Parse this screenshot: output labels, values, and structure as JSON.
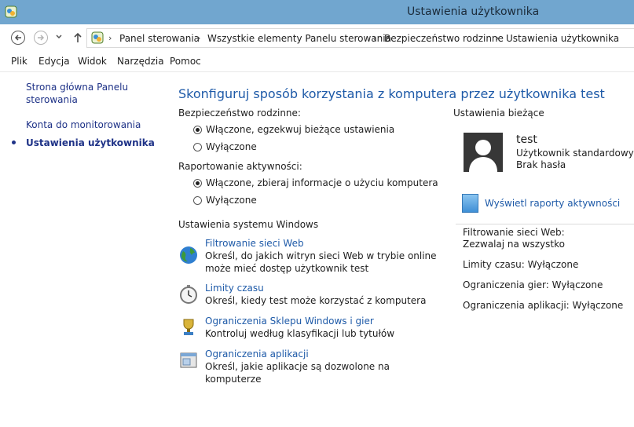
{
  "window": {
    "title": "Ustawienia użytkownika"
  },
  "breadcrumb": [
    "Panel sterowania",
    "Wszystkie elementy Panelu sterowania",
    "Bezpieczeństwo rodzinne",
    "Ustawienia użytkownika"
  ],
  "menu": [
    "Plik",
    "Edycja",
    "Widok",
    "Narzędzia",
    "Pomoc"
  ],
  "sidebar": {
    "items": [
      {
        "label_line1": "Strona główna Panelu",
        "label_line2": "sterowania"
      },
      {
        "label": "Konta do monitorowania"
      },
      {
        "label": "Ustawienia użytkownika",
        "current": true
      }
    ]
  },
  "main": {
    "heading": "Skonfiguruj sposób korzystania z komputera przez użytkownika test",
    "family_safety": {
      "label": "Bezpieczeństwo rodzinne:",
      "options": [
        "Włączone, egzekwuj bieżące ustawienia",
        "Wyłączone"
      ],
      "selected": 0
    },
    "activity_reporting": {
      "label": "Raportowanie aktywności:",
      "options": [
        "Włączone, zbieraj informacje o użyciu komputera",
        "Wyłączone"
      ],
      "selected": 0
    },
    "windows_settings_label": "Ustawienia systemu Windows",
    "settings": [
      {
        "icon": "globe-icon",
        "title": "Filtrowanie sieci Web",
        "desc": "Określ, do jakich witryn sieci Web w trybie online może mieć dostęp użytkownik test"
      },
      {
        "icon": "stopwatch-icon",
        "title": "Limity czasu",
        "desc": "Określ, kiedy test może korzystać z komputera"
      },
      {
        "icon": "trophy-icon",
        "title": "Ograniczenia Sklepu Windows i gier",
        "desc": "Kontroluj według klasyfikacji lub tytułów"
      },
      {
        "icon": "app-window-icon",
        "title": "Ograniczenia aplikacji",
        "desc": "Określ, jakie aplikacje są dozwolone na komputerze"
      }
    ]
  },
  "right": {
    "current_label": "Ustawienia bieżące",
    "user_name": "test",
    "user_type": "Użytkownik standardowy",
    "password_status": "Brak hasła",
    "reports_link": "Wyświetl raporty aktywności",
    "web_filter_label": "Filtrowanie sieci Web:",
    "web_filter_value": "Zezwalaj na wszystko",
    "time_limits": "Limity czasu: Wyłączone",
    "game_limits": "Ograniczenia gier: Wyłączone",
    "app_limits": "Ograniczenia aplikacji: Wyłączone"
  }
}
